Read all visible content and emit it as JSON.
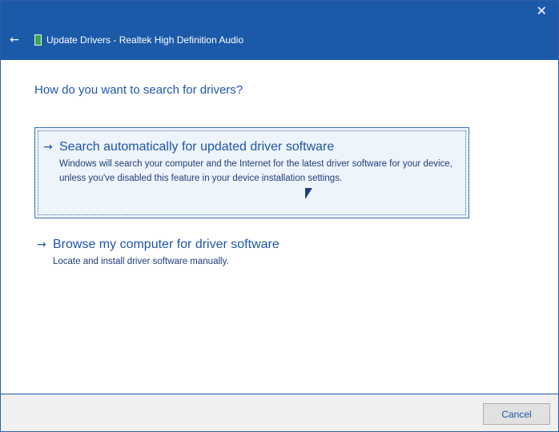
{
  "window": {
    "close_glyph": "✕",
    "title": "Update Drivers - Realtek High Definition Audio"
  },
  "header": {
    "back_glyph": "←",
    "device_icon": "green-device-icon"
  },
  "main": {
    "question": "How do you want to search for drivers?",
    "options": [
      {
        "arrow": "→",
        "title": "Search automatically for updated driver software",
        "description": "Windows will search your computer and the Internet for the latest driver software for your device, unless you've disabled this feature in your device installation settings."
      },
      {
        "arrow": "→",
        "title": "Browse my computer for driver software",
        "description": "Locate and install driver software manually."
      }
    ]
  },
  "footer": {
    "cancel_label": "Cancel"
  },
  "colors": {
    "titlebar": "#1b5aa8",
    "accent_text": "#1e56a8",
    "selected_option_bg": "#eef4fb"
  }
}
